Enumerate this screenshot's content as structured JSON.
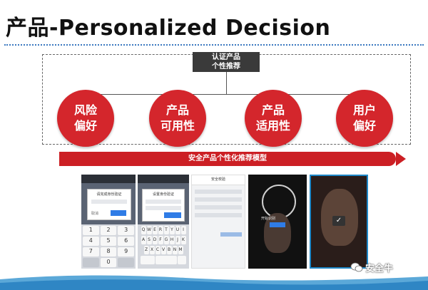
{
  "slide": {
    "title": "产品-Personalized Decision",
    "top_label_line1": "认证产品",
    "top_label_line2": "个性推荐",
    "circles": [
      {
        "line1": "风险",
        "line2": "偏好"
      },
      {
        "line1": "产品",
        "line2": "可用性"
      },
      {
        "line1": "产品",
        "line2": "适用性"
      },
      {
        "line1": "用户",
        "line2": "偏好"
      }
    ],
    "banner": "安全产品个性化推荐模型",
    "watermark": "安全牛"
  },
  "colors": {
    "accent_red": "#d4262c",
    "banner_red": "#cc1f24",
    "label_dark": "#3a3a3a",
    "title_rule_blue": "#3a78c0"
  },
  "screens": {
    "shot1_dialog_title": "请完成身份验证",
    "shot1_cancel": "取消",
    "shot2_dialog_title": "设置身份验证",
    "shot3_header": "安全校验",
    "shot4_caption": "开始识别"
  }
}
